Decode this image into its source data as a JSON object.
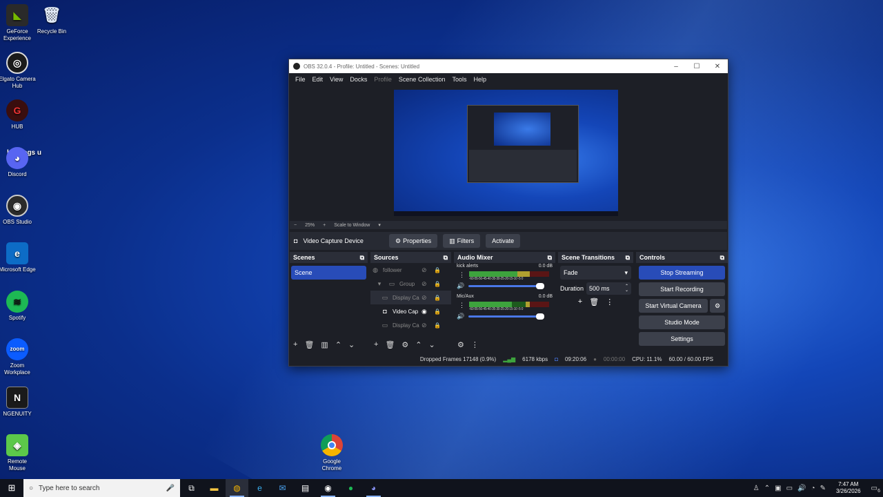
{
  "desktop": {
    "icons": [
      {
        "label": "GeForce Experience",
        "icon": "geforce-icon",
        "color": "#2a2a2a",
        "glyph": "◣"
      },
      {
        "label": "Recycle Bin",
        "icon": "recycle-bin-icon",
        "color": "transparent",
        "glyph": "🗑"
      },
      {
        "label": "Elgato Camera Hub",
        "icon": "elgato-camera-hub-icon",
        "color": "#1b1b1b",
        "glyph": "◎"
      },
      {
        "label": "HUB",
        "icon": "hub-icon",
        "color": "#3a0e0e",
        "glyph": "G"
      },
      {
        "label": "Discord",
        "icon": "discord-icon",
        "color": "#5865f2",
        "glyph": "◕"
      },
      {
        "label": "OBS Studio",
        "icon": "obs-studio-icon",
        "color": "#2b2b2b",
        "glyph": "◉"
      },
      {
        "label": "Microsoft Edge",
        "icon": "edge-icon",
        "color": "#0d6cc6",
        "glyph": "e"
      },
      {
        "label": "Spotify",
        "icon": "spotify-icon",
        "color": "#1db954",
        "glyph": "≋"
      },
      {
        "label": "Zoom Workplace",
        "icon": "zoom-icon",
        "color": "#0b5cff",
        "glyph": "zoom"
      },
      {
        "label": "NGENUITY",
        "icon": "ngenuity-icon",
        "color": "#1a1a1a",
        "glyph": "N"
      },
      {
        "label": "Remote Mouse",
        "icon": "remote-mouse-icon",
        "color": "#5cc84a",
        "glyph": "◈"
      },
      {
        "label": "Google Chrome",
        "icon": "chrome-icon",
        "color": "transparent",
        "glyph": "◍"
      }
    ],
    "overlay_text": "he mogs u"
  },
  "obs": {
    "title": "OBS 32.0.4 - Profile: Untitled - Scenes: Untitled",
    "menu": [
      "File",
      "Edit",
      "View",
      "Docks",
      "Profile",
      "Scene Collection",
      "Tools",
      "Help"
    ],
    "zoom": {
      "minus": "−",
      "level": "25%",
      "plus": "+",
      "scale": "Scale to Window"
    },
    "context": {
      "source_name": "Video Capture Device",
      "properties": "Properties",
      "filters": "Filters",
      "activate": "Activate"
    },
    "scenes": {
      "title": "Scenes",
      "items": [
        "Scene"
      ]
    },
    "sources": {
      "title": "Sources",
      "items": [
        {
          "name": "follower",
          "icon": "browser-icon",
          "visible": false
        },
        {
          "name": "Group",
          "icon": "folder-icon",
          "visible": false
        },
        {
          "name": "Display Ca",
          "icon": "monitor-icon",
          "visible": false
        },
        {
          "name": "Video Cap",
          "icon": "camera-icon",
          "visible": true
        },
        {
          "name": "Display Ca",
          "icon": "monitor-icon",
          "visible": false
        }
      ]
    },
    "mixer": {
      "title": "Audio Mixer",
      "channels": [
        {
          "name": "kick alerts",
          "db": "0.0 dB",
          "level": 0.78
        },
        {
          "name": "Mic/Aux",
          "db": "0.0 dB",
          "level": 0.72
        }
      ],
      "scale": "-60-55-50-45-40-35-30-25-20-15-10 -5 0"
    },
    "transitions": {
      "title": "Scene Transitions",
      "selected": "Fade",
      "duration_label": "Duration",
      "duration": "500 ms"
    },
    "controls": {
      "title": "Controls",
      "stop_streaming": "Stop Streaming",
      "start_recording": "Start Recording",
      "start_virtual_camera": "Start Virtual Camera",
      "studio_mode": "Studio Mode",
      "settings": "Settings"
    },
    "status": {
      "dropped": "Dropped Frames 17148 (0.9%)",
      "bitrate": "6178 kbps",
      "stream_time": "09:20:06",
      "rec_time": "00:00:00",
      "cpu": "CPU: 11.1%",
      "fps": "60.00 / 60.00 FPS"
    }
  },
  "taskbar": {
    "search_placeholder": "Type here to search",
    "time": "7:47 AM",
    "date": "3/26/2026",
    "notification_count": "6"
  },
  "colors": {
    "accent": "#284cb8",
    "meter_green": "#3da33d",
    "meter_red": "#a32424"
  }
}
